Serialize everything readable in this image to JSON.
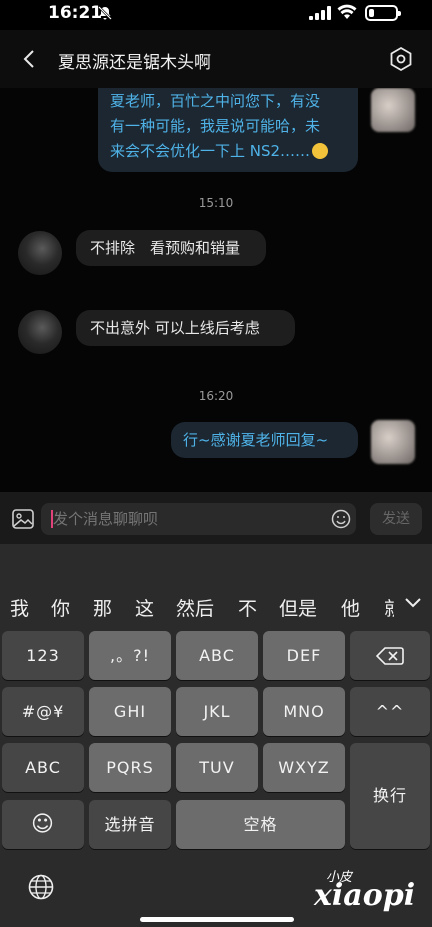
{
  "status": {
    "time": "16:21",
    "battery_level": 0.2,
    "icons": [
      "bell-off-icon",
      "signal-icon",
      "wifi-icon",
      "battery-icon"
    ]
  },
  "header": {
    "title": "夏思源还是锯木头啊",
    "back_icon": "chevron-left-icon",
    "settings_icon": "settings-hexagon-icon"
  },
  "chat": {
    "messages": [
      {
        "side": "out",
        "lines": [
          "夏老师，百忙之中问您下，有没",
          "有一种可能，我是说可能哈，未",
          "来会不会优化一下上 NS2……"
        ],
        "emoji": "sweat-smile-emoji"
      },
      {
        "type": "time",
        "text": "15:10"
      },
      {
        "side": "in",
        "text": "不排除　看预购和销量"
      },
      {
        "side": "in",
        "text": "不出意外  可以上线后考虑"
      },
      {
        "type": "time",
        "text": "16:20"
      },
      {
        "side": "out",
        "text": "行~感谢夏老师回复~"
      }
    ]
  },
  "composer": {
    "placeholder": "发个消息聊聊呗",
    "send_label": "发送"
  },
  "keyboard": {
    "candidates": [
      "我",
      "你",
      "那",
      "这",
      "然后",
      "不",
      "但是",
      "他",
      "就"
    ],
    "rows": [
      [
        "123",
        ",。?!",
        "ABC",
        "DEF",
        "⌫"
      ],
      [
        "#@¥",
        "GHI",
        "JKL",
        "MNO",
        "^^"
      ],
      [
        "ABC",
        "PQRS",
        "TUV",
        "WXYZ",
        "换行"
      ],
      [
        "☺",
        "选拼音",
        "空格"
      ]
    ]
  },
  "watermark": {
    "small": "小皮",
    "big": "xiaopi"
  }
}
